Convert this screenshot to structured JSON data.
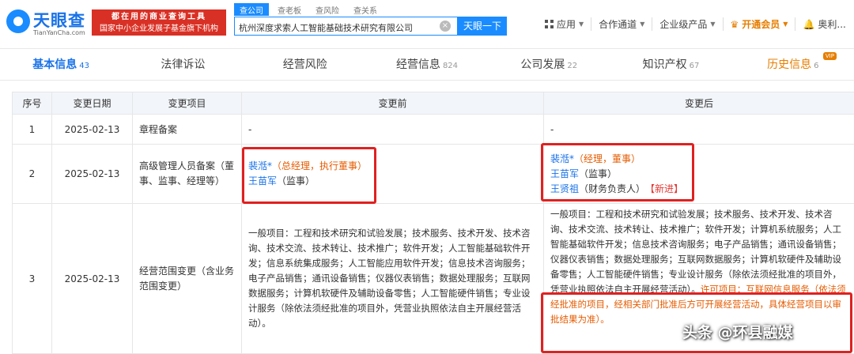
{
  "header": {
    "logo_text": "天眼查",
    "logo_sub": "TianYanCha.com",
    "ad_line1": "都在用的商业查询工具",
    "ad_line2": "国家中小企业发展子基金旗下机构",
    "search_tabs": [
      "查公司",
      "查老板",
      "查风险",
      "查关系"
    ],
    "search_value": "杭州深度求索人工智能基础技术研究有限公司",
    "search_button": "天眼一下",
    "nav": {
      "apps": "应用",
      "cooperation": "合作通道",
      "enterprise": "企业级产品",
      "vip": "开通会员",
      "user": "奥利..."
    }
  },
  "tabs": [
    {
      "label": "基本信息",
      "count": "43"
    },
    {
      "label": "法律诉讼",
      "count": ""
    },
    {
      "label": "经营风险",
      "count": ""
    },
    {
      "label": "经营信息",
      "count": "824"
    },
    {
      "label": "公司发展",
      "count": "22"
    },
    {
      "label": "知识产权",
      "count": "67"
    },
    {
      "label": "历史信息",
      "count": "6",
      "badge": "VIP"
    }
  ],
  "table": {
    "headers": [
      "序号",
      "变更日期",
      "变更项目",
      "变更前",
      "变更后"
    ],
    "rows": [
      {
        "no": "1",
        "date": "2025-02-13",
        "item": "章程备案",
        "before": "-",
        "after": "-"
      },
      {
        "no": "2",
        "date": "2025-02-13",
        "item": "高级管理人员备案（董事、监事、经理等）",
        "before_people": [
          {
            "name": "裴湉*",
            "role": "（总经理，执行董事）"
          },
          {
            "name": "王苗军",
            "role": "（监事）"
          }
        ],
        "after_people": [
          {
            "name": "裴湉*",
            "role": "（经理，董事）"
          },
          {
            "name": "王苗军",
            "role": "（监事）"
          },
          {
            "name": "王贤祖",
            "role": "（财务负责人）",
            "tag": "【新进】"
          }
        ]
      },
      {
        "no": "3",
        "date": "2025-02-13",
        "item": "经营范围变更（含业务范围变更）",
        "before": "一般项目：工程和技术研究和试验发展；技术服务、技术开发、技术咨询、技术交流、技术转让、技术推广；软件开发；人工智能基础软件开发；信息系统集成服务；人工智能应用软件开发；信息技术咨询服务；电子产品销售；通讯设备销售；仪器仪表销售；数据处理服务；互联网数据服务；计算机软硬件及辅助设备零售；人工智能硬件销售；专业设计服务（除依法须经批准的项目外，凭营业执照依法自主开展经营活动）。",
        "after": "一般项目：工程和技术研究和试验发展；技术服务、技术开发、技术咨询、技术交流、技术转让、技术推广；软件开发；计算机系统服务；人工智能基础软件开发；信息技术咨询服务；电子产品销售；通讯设备销售；仪器仪表销售；数据处理服务；互联网数据服务；计算机软硬件及辅助设备零售；人工智能硬件销售；专业设计服务（除依法须经批准的项目外，凭营业执照依法自主开展经营活动）。",
        "after_extra": "许可项目：互联网信息服务（依法须经批准的项目，经相关部门批准后方可开展经营活动，具体经营项目以审批结果为准）。"
      }
    ]
  },
  "watermark": "头条 @环县融媒"
}
